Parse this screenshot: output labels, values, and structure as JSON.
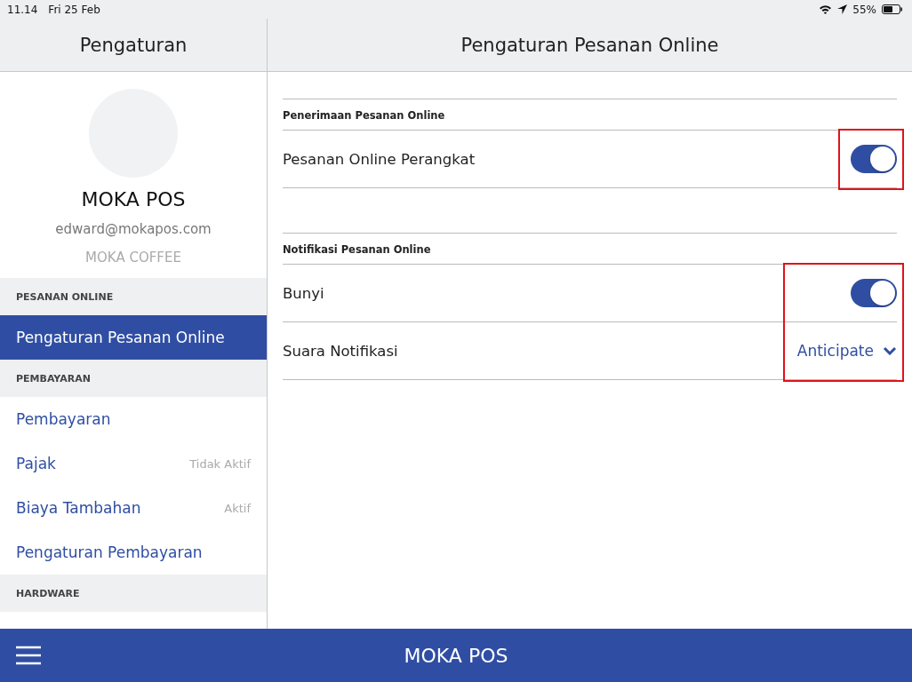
{
  "status_bar": {
    "time": "11.14",
    "date": "Fri 25 Feb",
    "battery": "55%"
  },
  "sidebar": {
    "title": "Pengaturan",
    "profile": {
      "name": "MOKA POS",
      "email": "edward@mokapos.com",
      "company": "MOKA COFFEE"
    },
    "items": [
      {
        "kind": "header",
        "label": "PESANAN ONLINE"
      },
      {
        "kind": "item",
        "label": "Pengaturan Pesanan Online",
        "selected": true
      },
      {
        "kind": "header",
        "label": "PEMBAYARAN"
      },
      {
        "kind": "item",
        "label": "Pembayaran",
        "selected": false
      },
      {
        "kind": "item",
        "label": "Pajak",
        "status": "Tidak Aktif",
        "selected": false
      },
      {
        "kind": "item",
        "label": "Biaya Tambahan",
        "status": "Aktif",
        "selected": false
      },
      {
        "kind": "item",
        "label": "Pengaturan Pembayaran",
        "selected": false
      },
      {
        "kind": "header",
        "label": "HARDWARE"
      }
    ]
  },
  "main": {
    "title": "Pengaturan Pesanan Online",
    "sections": [
      {
        "title": "Penerimaan Pesanan Online",
        "highlighted": true,
        "rows": [
          {
            "kind": "toggle",
            "label": "Pesanan Online Perangkat",
            "on": true
          }
        ]
      },
      {
        "title": "Notifikasi Pesanan Online",
        "highlighted": true,
        "rows": [
          {
            "kind": "toggle",
            "label": "Bunyi",
            "on": true
          },
          {
            "kind": "select",
            "label": "Suara Notifikasi",
            "value": "Anticipate"
          }
        ]
      }
    ]
  },
  "bottom_bar": {
    "title": "MOKA POS"
  }
}
